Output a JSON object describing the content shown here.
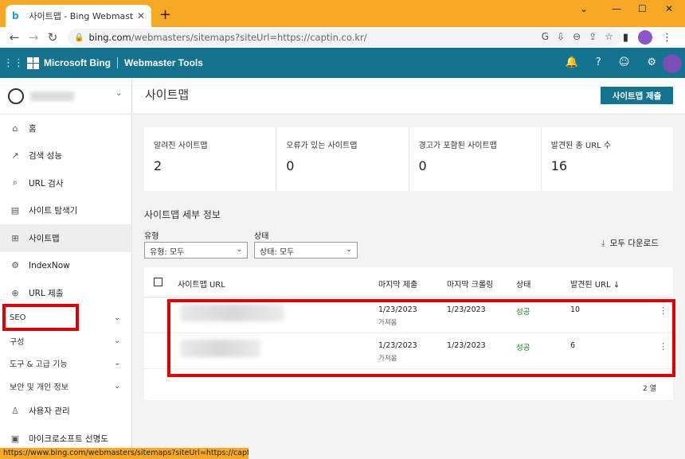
{
  "browser": {
    "tab_title": "사이트맵 - Bing Webmaster Tools",
    "tab_close": "✕",
    "new_tab": "+",
    "url_domain": "bing.com",
    "url_rest": "/webmasters/sitemaps?siteUrl=https://captin.co.kr/",
    "status_url": "https://www.bing.com/webmasters/sitemaps?siteUrl=https://captin.co.kr/"
  },
  "header": {
    "brand": "Microsoft Bing",
    "product": "Webmaster Tools"
  },
  "sidebar": {
    "items": [
      {
        "label": "홈",
        "icon": "home-icon"
      },
      {
        "label": "검색 성능",
        "icon": "trend-icon"
      },
      {
        "label": "URL 검사",
        "icon": "search-icon"
      },
      {
        "label": "사이트 탐색기",
        "icon": "document-icon"
      },
      {
        "label": "사이트맵",
        "icon": "sitemap-icon"
      },
      {
        "label": "IndexNow",
        "icon": "gear-icon"
      },
      {
        "label": "URL 제출",
        "icon": "globe-icon"
      }
    ],
    "groups": [
      "SEO",
      "구성",
      "도구 & 고급 기능",
      "보안 및 개인 정보"
    ],
    "bottom_items": [
      {
        "label": "사용자 관리",
        "icon": "user-icon"
      },
      {
        "label": "마이크로소프트 선명도",
        "icon": "clarity-icon"
      }
    ]
  },
  "main": {
    "title": "사이트맵",
    "submit_button": "사이트맵 제출",
    "stats": [
      {
        "label": "알려진 사이트맵",
        "value": "2"
      },
      {
        "label": "오류가 있는 사이트맵",
        "value": "0"
      },
      {
        "label": "경고가 포함된 사이트맵",
        "value": "0"
      },
      {
        "label": "발견된 총 URL 수",
        "value": "16"
      }
    ],
    "section_title": "사이트맵 세부 정보",
    "filters": {
      "type_label": "유형",
      "type_value": "유형: 모두",
      "status_label": "상태",
      "status_value": "상태: 모두"
    },
    "download_all": "모두 다운로드",
    "table": {
      "headers": [
        "사이트맵 URL",
        "마지막 제출",
        "마지막 크롤링",
        "상태",
        "발견된 URL"
      ],
      "rows": [
        {
          "submitted": "1/23/2023",
          "submitted_sub": "가져옴",
          "crawled": "1/23/2023",
          "status": "성공",
          "urls": "10"
        },
        {
          "submitted": "1/23/2023",
          "submitted_sub": "가져옴",
          "crawled": "1/23/2023",
          "status": "성공",
          "urls": "6"
        }
      ],
      "count": "2 열"
    }
  },
  "colors": {
    "accent": "#14748f",
    "tabbar": "#f7a825",
    "highlight": "#e00000",
    "success": "#107c10"
  }
}
